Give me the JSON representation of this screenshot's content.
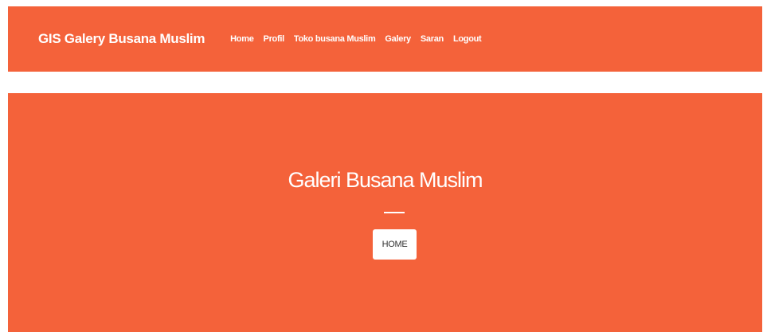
{
  "navbar": {
    "brand": "GIS Galery Busana Muslim",
    "links": [
      {
        "label": "Home"
      },
      {
        "label": "Profil"
      },
      {
        "label": "Toko busana Muslim"
      },
      {
        "label": "Galery"
      },
      {
        "label": "Saran"
      },
      {
        "label": "Logout"
      }
    ]
  },
  "hero": {
    "title": "Galeri Busana Muslim",
    "button_label": "HOME"
  },
  "colors": {
    "accent": "#f4623a",
    "text_light": "#ffffff",
    "button_text": "#333333"
  }
}
